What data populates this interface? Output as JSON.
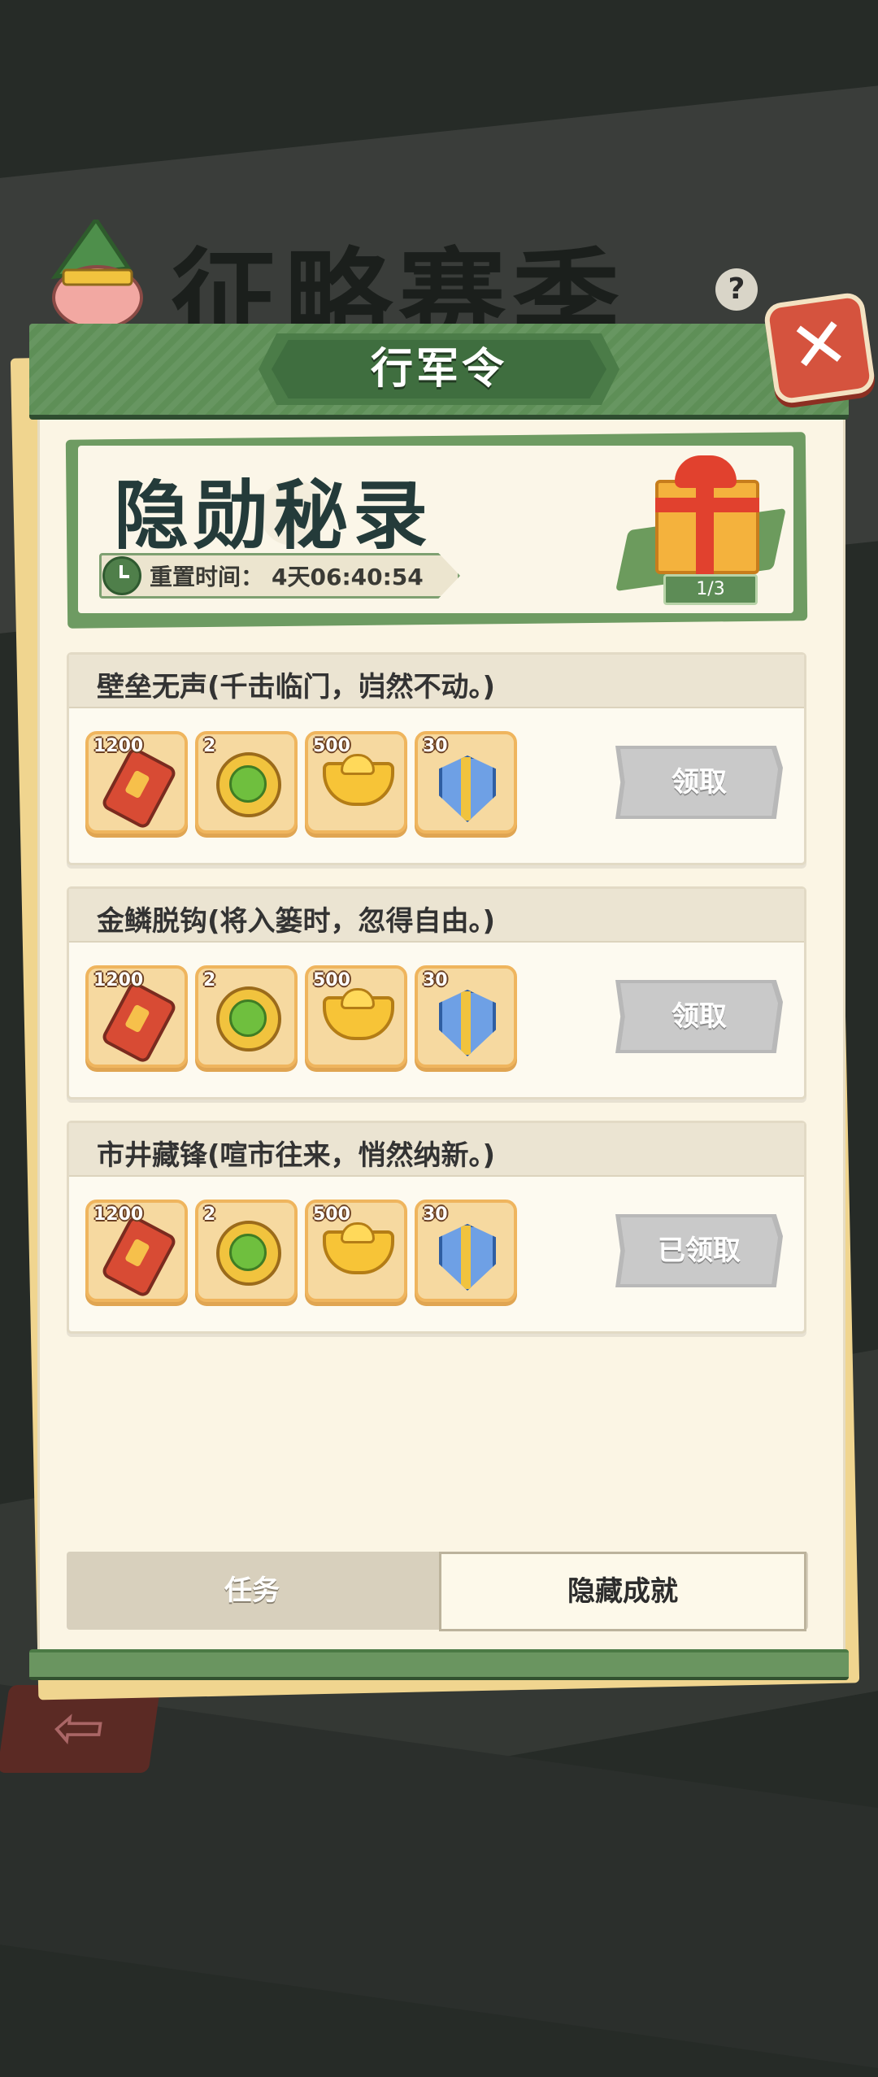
{
  "background": {
    "title": "征略赛季",
    "help_glyph": "?",
    "back_glyph": "⇦"
  },
  "header": {
    "title": "行军令",
    "close_glyph": "✕"
  },
  "hero": {
    "title": "隐勋秘录",
    "reset_label": "重置时间：",
    "reset_value": "4天06:40:54",
    "gift_count": "1/3"
  },
  "tasks": [
    {
      "title": "壁垒无声(千击临门，岿然不动。)",
      "rewards": [
        {
          "icon": "blade-token-icon",
          "count": "1200"
        },
        {
          "icon": "jade-coin-icon",
          "count": "2"
        },
        {
          "icon": "gold-ingot-icon",
          "count": "500"
        },
        {
          "icon": "shield-sword-icon",
          "count": "30"
        }
      ],
      "button": "领取"
    },
    {
      "title": "金鳞脱钩(将入篓时，忽得自由。)",
      "rewards": [
        {
          "icon": "blade-token-icon",
          "count": "1200"
        },
        {
          "icon": "jade-coin-icon",
          "count": "2"
        },
        {
          "icon": "gold-ingot-icon",
          "count": "500"
        },
        {
          "icon": "shield-sword-icon",
          "count": "30"
        }
      ],
      "button": "领取"
    },
    {
      "title": "市井藏锋(喧市往来，悄然纳新。)",
      "rewards": [
        {
          "icon": "blade-token-icon",
          "count": "1200"
        },
        {
          "icon": "jade-coin-icon",
          "count": "2"
        },
        {
          "icon": "gold-ingot-icon",
          "count": "500"
        },
        {
          "icon": "shield-sword-icon",
          "count": "30"
        }
      ],
      "button": "已领取"
    }
  ],
  "tabs": {
    "task": "任务",
    "hidden": "隐藏成就"
  },
  "colors": {
    "panel_green": "#5e8f57",
    "close_red": "#d5533e",
    "paper": "#fbf5e4",
    "disabled_button": "#c9c9c9"
  }
}
